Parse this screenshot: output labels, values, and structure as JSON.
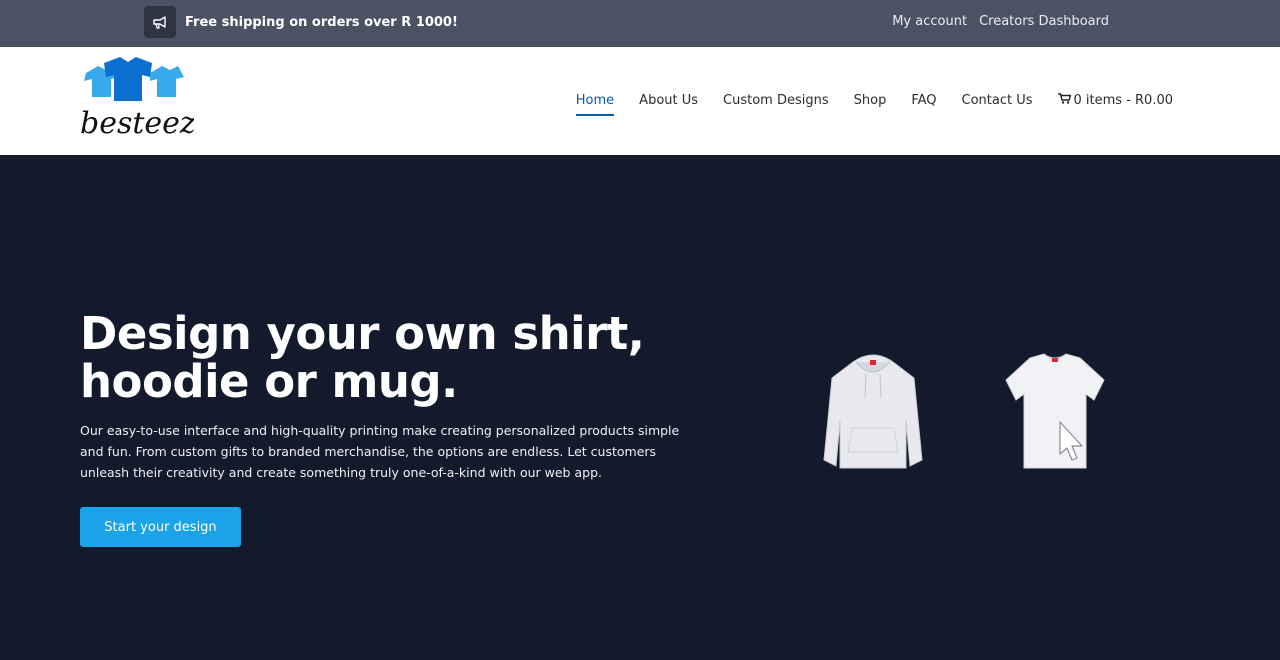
{
  "topbar": {
    "promo_icon": "megaphone-icon",
    "promo_text": "Free shipping on orders over R 1000!",
    "links": [
      "My account",
      "Creators Dashboard"
    ]
  },
  "header": {
    "logo_text": "besteez",
    "nav": [
      "Home",
      "About Us",
      "Custom Designs",
      "Shop",
      "FAQ",
      "Contact Us"
    ],
    "active_nav": "Home",
    "cart_icon": "cart-icon",
    "cart_label": "0 items - R0.00"
  },
  "hero": {
    "title_line1": "Design your own shirt,",
    "title_line2": "hoodie or mug.",
    "description": "Our easy-to-use interface and high-quality printing make creating personalized products simple and fun. From custom gifts to branded merchandise, the options are endless. Let customers unleash their creativity and create something truly one-of-a-kind with our web app.",
    "cta_label": "Start your design"
  },
  "colors": {
    "topbar": "#4b5264",
    "hero_bg": "#131a2b",
    "accent": "#1aa3e6",
    "nav_active": "#0a5bab"
  }
}
